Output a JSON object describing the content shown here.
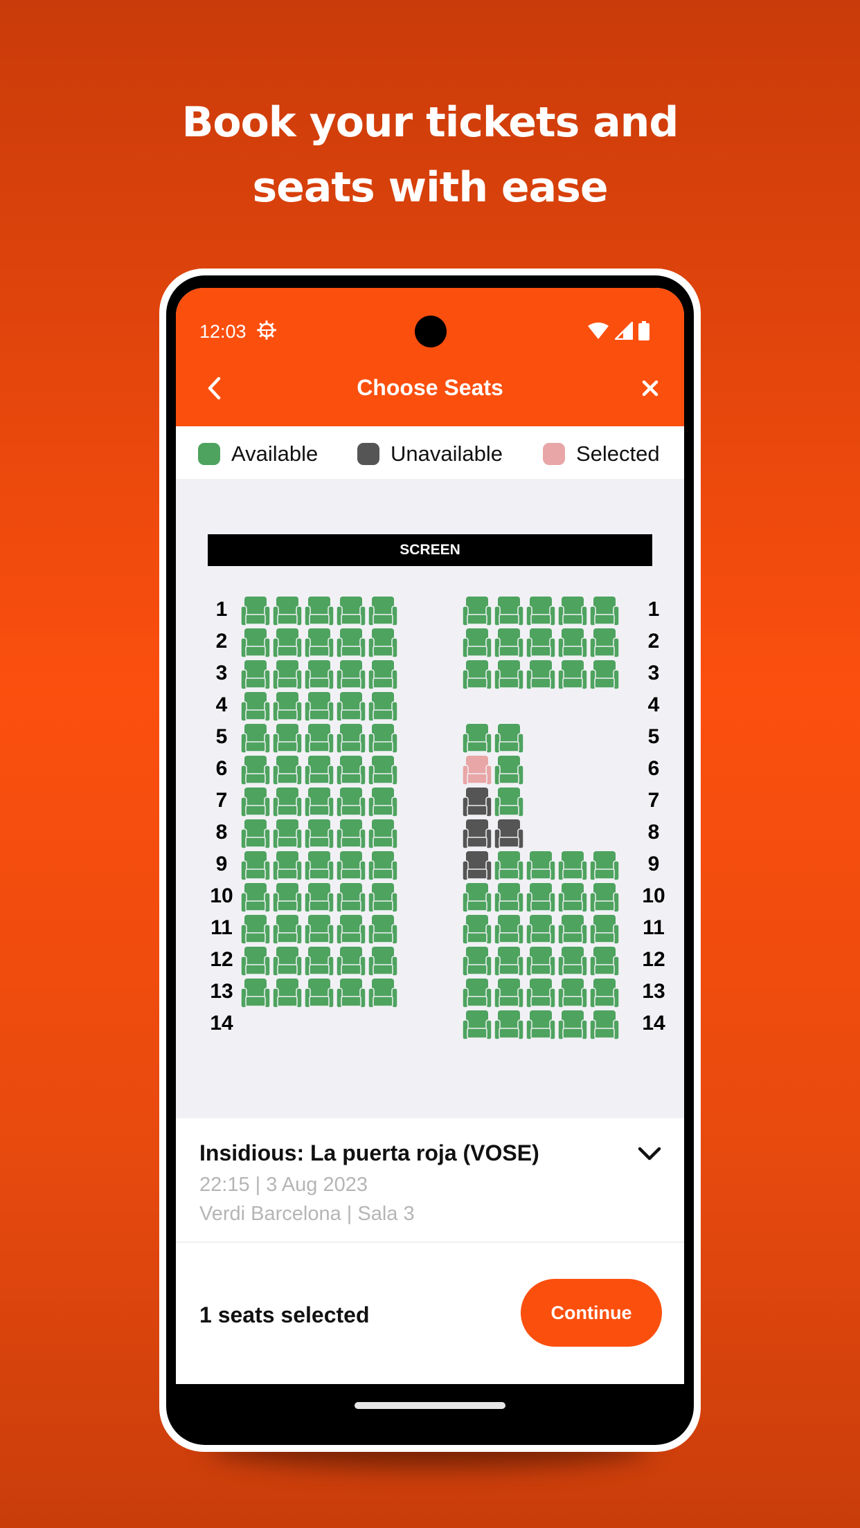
{
  "headline": {
    "line1": "Book your tickets and",
    "line2": "seats with ease"
  },
  "status_bar": {
    "time": "12:03",
    "icons": [
      "gear-icon",
      "wifi-icon",
      "signal-icon",
      "battery-icon"
    ]
  },
  "app_bar": {
    "title": "Choose Seats",
    "back_icon": "chevron-left-icon",
    "close_icon": "close-icon"
  },
  "legend": [
    {
      "label": "Available",
      "color": "#4ea35f"
    },
    {
      "label": "Unavailable",
      "color": "#555555"
    },
    {
      "label": "Selected",
      "color": "#e8a6a6"
    }
  ],
  "colors": {
    "accent": "#fb4f0e",
    "available": "#4ea35f",
    "unavailable": "#555555",
    "selected": "#e8a6a6"
  },
  "seatmap": {
    "screen_label": "SCREEN",
    "row_labels": [
      "1",
      "2",
      "3",
      "4",
      "5",
      "6",
      "7",
      "8",
      "9",
      "10",
      "11",
      "12",
      "13",
      "14"
    ],
    "left_block": [
      [
        "A",
        "A",
        "A",
        "A",
        "A"
      ],
      [
        "A",
        "A",
        "A",
        "A",
        "A"
      ],
      [
        "A",
        "A",
        "A",
        "A",
        "A"
      ],
      [
        "A",
        "A",
        "A",
        "A",
        "A"
      ],
      [
        "A",
        "A",
        "A",
        "A",
        "A"
      ],
      [
        "A",
        "A",
        "A",
        "A",
        "A"
      ],
      [
        "A",
        "A",
        "A",
        "A",
        "A"
      ],
      [
        "A",
        "A",
        "A",
        "A",
        "A"
      ],
      [
        "A",
        "A",
        "A",
        "A",
        "A"
      ],
      [
        "A",
        "A",
        "A",
        "A",
        "A"
      ],
      [
        "A",
        "A",
        "A",
        "A",
        "A"
      ],
      [
        "A",
        "A",
        "A",
        "A",
        "A"
      ],
      [
        "A",
        "A",
        "A",
        "A",
        "A"
      ],
      [
        "-",
        "-",
        "-",
        "-",
        "-"
      ]
    ],
    "right_block": [
      [
        "A",
        "A",
        "A",
        "A",
        "A"
      ],
      [
        "A",
        "A",
        "A",
        "A",
        "A"
      ],
      [
        "A",
        "A",
        "A",
        "A",
        "A"
      ],
      [
        "-",
        "-",
        "-",
        "-",
        "-"
      ],
      [
        "A",
        "A",
        "-",
        "-",
        "-"
      ],
      [
        "S",
        "A",
        "-",
        "-",
        "-"
      ],
      [
        "U",
        "A",
        "-",
        "-",
        "-"
      ],
      [
        "U",
        "U",
        "-",
        "-",
        "-"
      ],
      [
        "U",
        "A",
        "A",
        "A",
        "A"
      ],
      [
        "A",
        "A",
        "A",
        "A",
        "A"
      ],
      [
        "A",
        "A",
        "A",
        "A",
        "A"
      ],
      [
        "A",
        "A",
        "A",
        "A",
        "A"
      ],
      [
        "A",
        "A",
        "A",
        "A",
        "A"
      ],
      [
        "A",
        "A",
        "A",
        "A",
        "A"
      ]
    ]
  },
  "movie": {
    "title": "Insidious: La puerta roja (VOSE)",
    "datetime": "22:15 | 3 Aug 2023",
    "venue": "Verdi Barcelona | Sala 3",
    "expand_icon": "chevron-down-icon"
  },
  "footer": {
    "seat_count": "1 seats selected",
    "continue_label": "Continue"
  }
}
